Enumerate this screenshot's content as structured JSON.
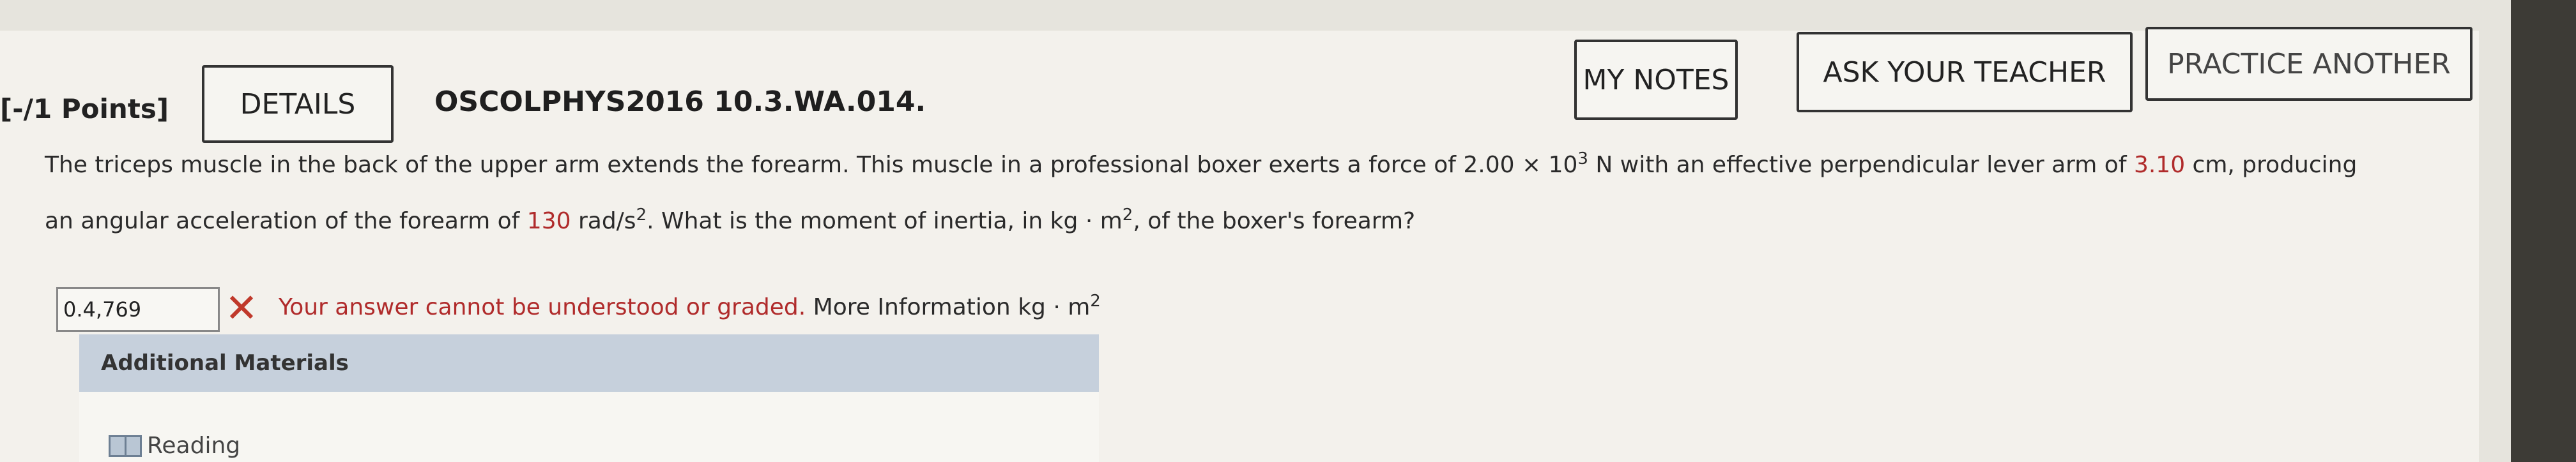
{
  "header": {
    "points": "[-/1 Points]",
    "details_label": "DETAILS",
    "question_id": "OSCOLPHYS2016 10.3.WA.014.",
    "my_notes_label": "MY NOTES",
    "ask_teacher_label": "ASK YOUR TEACHER",
    "practice_another_label": "PRACTICE ANOTHER"
  },
  "question": {
    "l1_a": "The triceps muscle in the back of the upper arm extends the forearm. This muscle in a professional boxer exerts a force of ",
    "force_value": "2.00 × 10",
    "force_exp": "3",
    "l1_b": " N with an effective perpendicular lever arm of ",
    "lever_value": "3.10",
    "l1_c": " cm, producing",
    "l2_a": "an angular acceleration of the forearm of ",
    "accel_value": "130",
    "l2_b": " rad/s",
    "l2_exp": "2",
    "l2_c": ". What is the moment of inertia, in kg · m",
    "l2_exp2": "2",
    "l2_d": ", of the boxer's forearm?"
  },
  "answer": {
    "value": "0.4,769",
    "status_icon": "x-mark-icon",
    "feedback": "Your answer cannot be understood or graded.",
    "more_info": " More Information",
    "unit": " kg · m",
    "unit_exp": "2"
  },
  "additional": {
    "title": "Additional Materials",
    "reading_label": "Reading",
    "reading_icon": "book-icon"
  },
  "colors": {
    "error_red": "#c0392b",
    "header_blue": "#c6d0dc"
  }
}
